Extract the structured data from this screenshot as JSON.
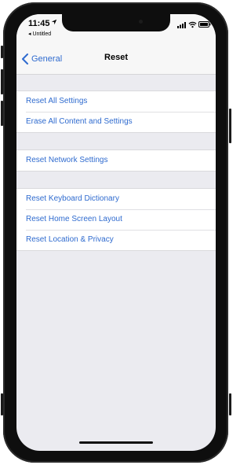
{
  "status_bar": {
    "time": "11:45",
    "back_app": "◂ Untitled",
    "icons": [
      "location-arrow-icon",
      "signal-icon",
      "wifi-icon",
      "battery-icon"
    ]
  },
  "nav": {
    "back_label": "General",
    "title": "Reset"
  },
  "groups": [
    {
      "items": [
        "Reset All Settings",
        "Erase All Content and Settings"
      ]
    },
    {
      "items": [
        "Reset Network Settings"
      ]
    },
    {
      "items": [
        "Reset Keyboard Dictionary",
        "Reset Home Screen Layout",
        "Reset Location & Privacy"
      ]
    }
  ],
  "colors": {
    "accent": "#2f6bcf",
    "background": "#ebebf0",
    "cell": "#ffffff"
  }
}
